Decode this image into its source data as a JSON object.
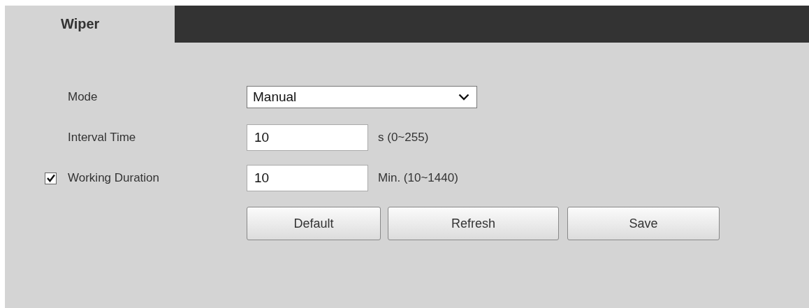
{
  "tabs": [
    {
      "label": "Wiper",
      "selected": true
    }
  ],
  "fields": [
    {
      "kind": "select",
      "label": "Mode",
      "value": "Manual"
    },
    {
      "kind": "input",
      "label": "Interval Time",
      "value": "10",
      "unit": "s (0~255)"
    },
    {
      "kind": "checkbox-input",
      "label": "Working Duration",
      "checked": true,
      "value": "10",
      "unit": "Min. (10~1440)"
    }
  ],
  "buttons": [
    "Default",
    "Refresh",
    "Save"
  ]
}
